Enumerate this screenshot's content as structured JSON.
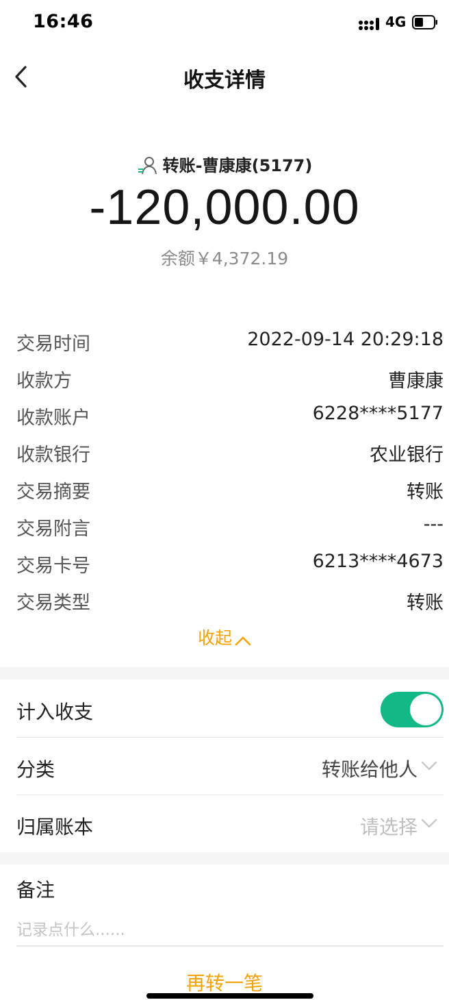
{
  "status_bar": {
    "time": "16:46",
    "network": "4G"
  },
  "header": {
    "title": "收支详情"
  },
  "summary": {
    "payee": "转账-曹康康(5177)",
    "amount": "-120,000.00",
    "balance": "余额￥4,372.19"
  },
  "details": [
    {
      "label": "交易时间",
      "value": "2022-09-14 20:29:18"
    },
    {
      "label": "收款方",
      "value": "曹康康"
    },
    {
      "label": "收款账户",
      "value": "6228****5177"
    },
    {
      "label": "收款银行",
      "value": "农业银行"
    },
    {
      "label": "交易摘要",
      "value": "转账"
    },
    {
      "label": "交易附言",
      "value": "---"
    },
    {
      "label": "交易卡号",
      "value": "6213****4673"
    },
    {
      "label": "交易类型",
      "value": "转账"
    }
  ],
  "collapse_label": "收起",
  "settings": {
    "include_label": "计入收支",
    "include_on": true,
    "category_label": "分类",
    "category_value": "转账给他人",
    "ledger_label": "归属账本",
    "ledger_placeholder": "请选择"
  },
  "note": {
    "label": "备注",
    "placeholder": "记录点什么......"
  },
  "again_label": "再转一笔",
  "colors": {
    "accent": "#f4a20a",
    "toggle": "#12b886"
  }
}
